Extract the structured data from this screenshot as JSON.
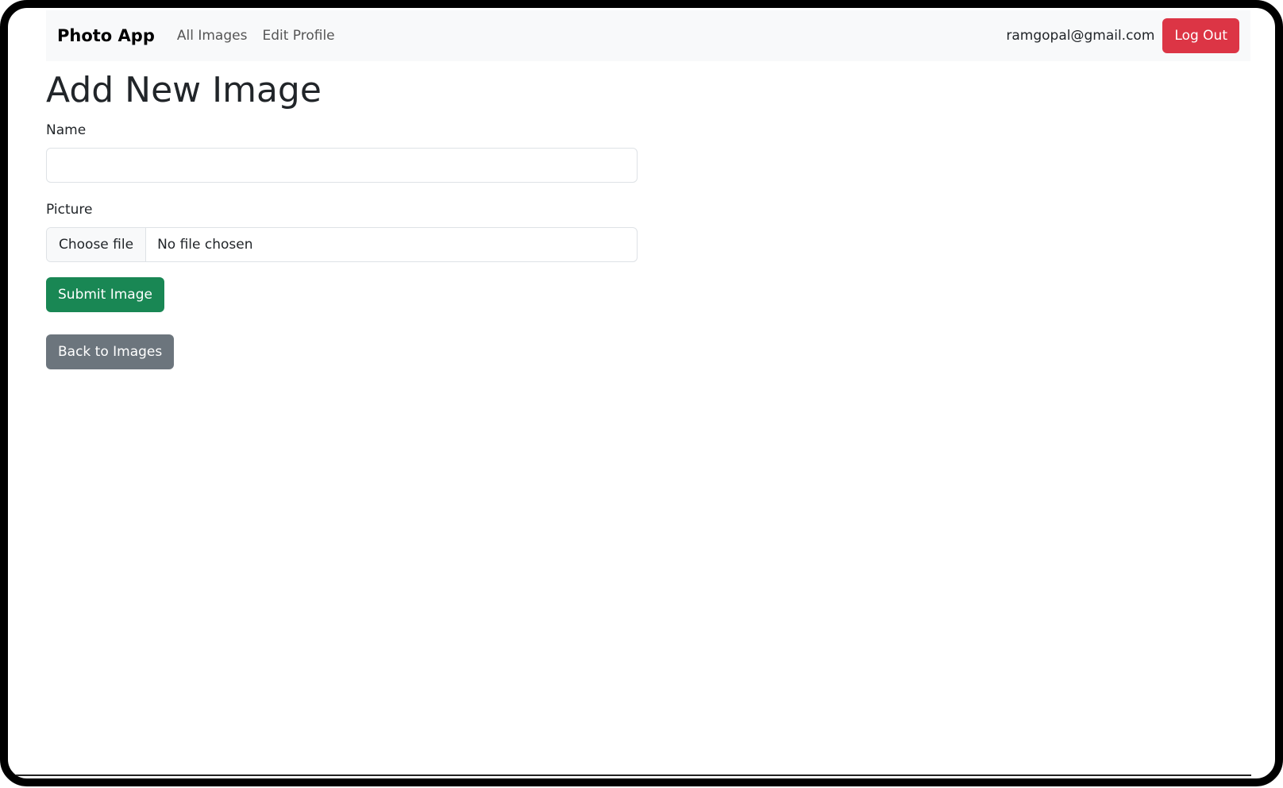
{
  "navbar": {
    "brand": "Photo App",
    "links": [
      "All Images",
      "Edit Profile"
    ],
    "user_email": "ramgopal@gmail.com",
    "logout_label": "Log Out"
  },
  "page": {
    "title": "Add New Image"
  },
  "form": {
    "name_label": "Name",
    "name_value": "",
    "picture_label": "Picture",
    "choose_file_label": "Choose file",
    "file_status": "No file chosen",
    "submit_label": "Submit Image"
  },
  "back_label": "Back to Images",
  "colors": {
    "logout": "#dc3545",
    "submit": "#198754",
    "back": "#6c757d",
    "navbar_bg": "#f8f9fa"
  }
}
